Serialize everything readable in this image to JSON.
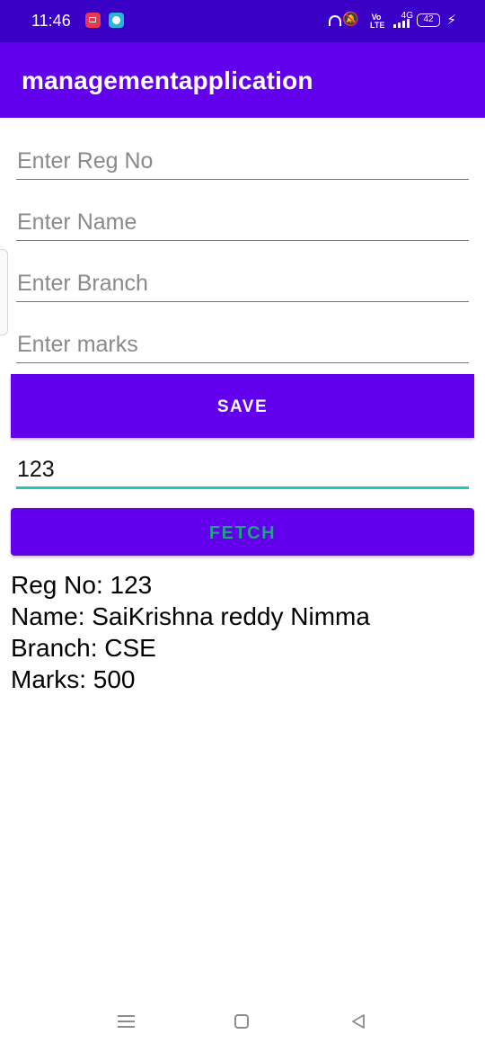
{
  "status_bar": {
    "time": "11:46",
    "network_label": "4G",
    "volte_label": "Vo LTE",
    "battery": "42"
  },
  "app_bar": {
    "title": "managementapplication"
  },
  "form": {
    "reg_placeholder": "Enter Reg No",
    "name_placeholder": "Enter Name",
    "branch_placeholder": "Enter Branch",
    "marks_placeholder": "Enter marks",
    "save_label": "SAVE"
  },
  "fetch": {
    "input_value": "123",
    "button_label": "FETCH"
  },
  "result": {
    "reg": "Reg No: 123",
    "name": "Name: SaiKrishna reddy Nimma",
    "branch": "Branch: CSE",
    "marks": "Marks: 500"
  },
  "colors": {
    "status_bar": "#3a00c8",
    "primary": "#6200ee",
    "accent": "#26c6b0",
    "fetch_text": "#1da37e"
  }
}
